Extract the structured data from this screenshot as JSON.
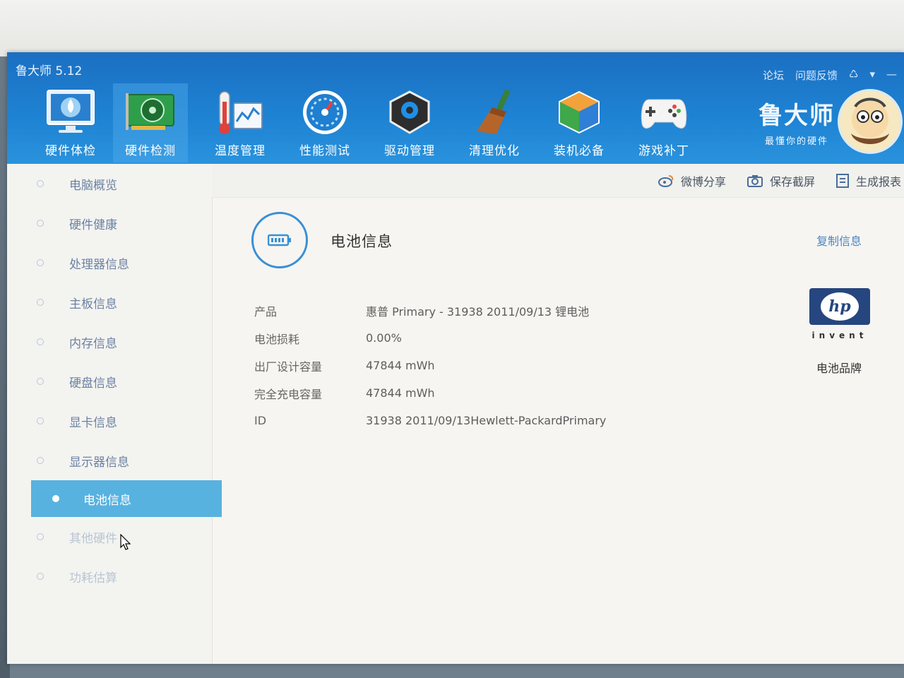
{
  "app": {
    "title": "鲁大师 5.12",
    "top_links": [
      "论坛",
      "问题反馈"
    ],
    "brand_name": "鲁大师",
    "brand_slogan": "最懂你的硬件"
  },
  "nav": {
    "items": [
      {
        "label": "硬件体检",
        "icon": "monitor-icon"
      },
      {
        "label": "硬件检测",
        "icon": "graphics-card-icon"
      },
      {
        "label": "温度管理",
        "icon": "thermometer-icon"
      },
      {
        "label": "性能测试",
        "icon": "speedometer-icon"
      },
      {
        "label": "驱动管理",
        "icon": "driver-gear-icon"
      },
      {
        "label": "清理优化",
        "icon": "broom-icon"
      },
      {
        "label": "装机必备",
        "icon": "cube-icon"
      },
      {
        "label": "游戏补丁",
        "icon": "gamepad-icon"
      }
    ],
    "active_index": 1
  },
  "sidebar": {
    "items": [
      {
        "label": "电脑概览"
      },
      {
        "label": "硬件健康"
      },
      {
        "label": "处理器信息"
      },
      {
        "label": "主板信息"
      },
      {
        "label": "内存信息"
      },
      {
        "label": "硬盘信息"
      },
      {
        "label": "显卡信息"
      },
      {
        "label": "显示器信息"
      },
      {
        "label": "电池信息"
      },
      {
        "label": "其他硬件"
      },
      {
        "label": "功耗估算"
      }
    ],
    "active_index": 8
  },
  "toolbar": {
    "weibo_share": "微博分享",
    "save_screenshot": "保存截屏",
    "generate_report": "生成报表"
  },
  "content": {
    "title": "电池信息",
    "copy_info": "复制信息",
    "rows": [
      {
        "label": "产品",
        "value": "惠普 Primary - 31938 2011/09/13 锂电池"
      },
      {
        "label": "电池损耗",
        "value": "0.00%"
      },
      {
        "label": "出厂设计容量",
        "value": "47844 mWh"
      },
      {
        "label": "完全充电容量",
        "value": "47844 mWh"
      },
      {
        "label": "ID",
        "value": "31938 2011/09/13Hewlett-PackardPrimary"
      }
    ],
    "brand_logo_text": "hp",
    "brand_logo_tagline": "invent",
    "brand_label": "电池品牌"
  },
  "colors": {
    "header_blue": "#1e83d3",
    "active_sidebar": "#58b2e0",
    "link_blue": "#4b86c4",
    "hp_navy": "#26467f"
  }
}
